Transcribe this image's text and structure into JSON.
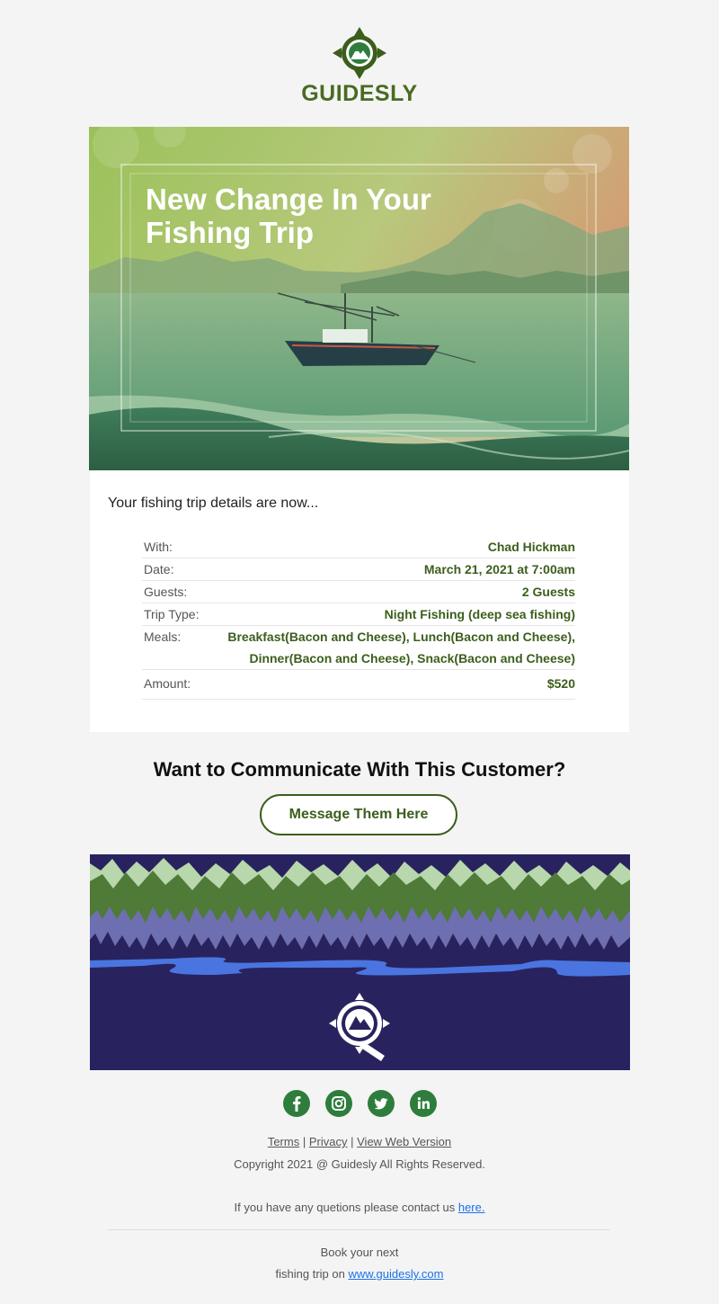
{
  "brand": {
    "name": "GUIDESLY",
    "color": "#4a6b22"
  },
  "hero": {
    "title": "New Change In Your Fishing Trip"
  },
  "details": {
    "intro": "Your fishing trip details are now...",
    "rows": [
      {
        "label": "With:",
        "value": "Chad Hickman"
      },
      {
        "label": "Date:",
        "value": "March 21, 2021 at 7:00am"
      },
      {
        "label": "Guests:",
        "value": "2 Guests"
      },
      {
        "label": "Trip Type:",
        "value": "Night Fishing (deep sea fishing)"
      },
      {
        "label": "Meals:",
        "value": "Breakfast(Bacon and Cheese), Lunch(Bacon and Cheese), Dinner(Bacon and Cheese), Snack(Bacon and Cheese)"
      },
      {
        "label": "Amount:",
        "value": "$520"
      }
    ]
  },
  "cta": {
    "title": "Want to Communicate With This Customer?",
    "button": "Message Them Here"
  },
  "social": [
    "facebook-icon",
    "instagram-icon",
    "twitter-icon",
    "linkedin-icon"
  ],
  "footer": {
    "terms": "Terms",
    "sep": "|",
    "privacy": "Privacy",
    "web_version": "View Web Version",
    "copyright": "Copyright 2021 @ Guidesly All Rights Reserved.",
    "contact_text": "If you have any quetions please contact us",
    "contact_link": "here.",
    "book_line1": "Book your next",
    "book_line2": "fishing trip on",
    "book_link": "www.guidesly.com"
  },
  "colors": {
    "accent_green": "#3c5e1c",
    "social_green": "#2f7d3c",
    "link_blue": "#1a73e8",
    "navy": "#28235e"
  }
}
